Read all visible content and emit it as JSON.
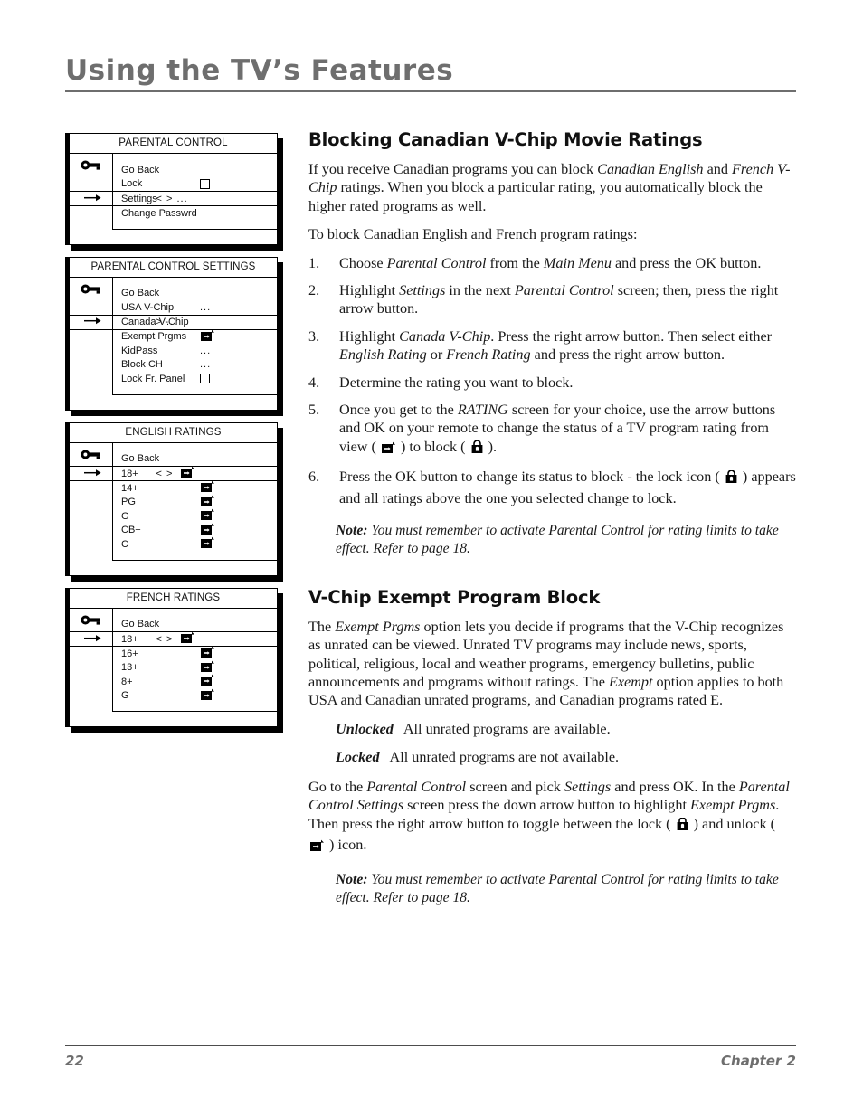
{
  "header": {
    "title": "Using the TV’s Features"
  },
  "footer": {
    "page_number": "22",
    "chapter": "Chapter 2"
  },
  "menus": [
    {
      "title": "PARENTAL CONTROL",
      "key_icon": "key-icon",
      "rows": [
        {
          "label": "Go Back",
          "value": "",
          "value_type": "none",
          "selected": false
        },
        {
          "label": "Lock",
          "value": "",
          "value_type": "checkbox",
          "selected": false
        },
        {
          "label": "Settings",
          "value": "< > ...",
          "value_type": "text",
          "selected": true
        },
        {
          "label": "Change Passwrd",
          "value": "",
          "value_type": "none",
          "selected": false
        }
      ]
    },
    {
      "title": "PARENTAL CONTROL SETTINGS",
      "key_icon": "key-icon",
      "rows": [
        {
          "label": "Go Back",
          "value": "",
          "value_type": "none",
          "selected": false
        },
        {
          "label": "USA V-Chip",
          "value": "...",
          "value_type": "text",
          "selected": false
        },
        {
          "label": "Canada V-Chip",
          "value": "> ...",
          "value_type": "text",
          "selected": true
        },
        {
          "label": "Exempt Prgms",
          "value": "",
          "value_type": "view-icon",
          "selected": false
        },
        {
          "label": "KidPass",
          "value": "...",
          "value_type": "text",
          "selected": false
        },
        {
          "label": "Block CH",
          "value": "...",
          "value_type": "text",
          "selected": false
        },
        {
          "label": "Lock Fr. Panel",
          "value": "",
          "value_type": "checkbox",
          "selected": false
        }
      ]
    },
    {
      "title": "ENGLISH RATINGS",
      "key_icon": "key-icon",
      "rows": [
        {
          "label": "Go Back",
          "value": "",
          "value_type": "none",
          "selected": false
        },
        {
          "label": "18+",
          "value": "< >",
          "value_type": "text-view-icon",
          "selected": true
        },
        {
          "label": "14+",
          "value": "",
          "value_type": "view-icon",
          "selected": false
        },
        {
          "label": "PG",
          "value": "",
          "value_type": "view-icon",
          "selected": false
        },
        {
          "label": "G",
          "value": "",
          "value_type": "view-icon",
          "selected": false
        },
        {
          "label": "CB+",
          "value": "",
          "value_type": "view-icon",
          "selected": false
        },
        {
          "label": "C",
          "value": "",
          "value_type": "view-icon",
          "selected": false
        }
      ]
    },
    {
      "title": "FRENCH RATINGS",
      "key_icon": "key-icon",
      "rows": [
        {
          "label": "Go Back",
          "value": "",
          "value_type": "none",
          "selected": false
        },
        {
          "label": "18+",
          "value": "< >",
          "value_type": "text-view-icon",
          "selected": true
        },
        {
          "label": "16+",
          "value": "",
          "value_type": "view-icon",
          "selected": false
        },
        {
          "label": "13+",
          "value": "",
          "value_type": "view-icon",
          "selected": false
        },
        {
          "label": "8+",
          "value": "",
          "value_type": "view-icon",
          "selected": false
        },
        {
          "label": "G",
          "value": "",
          "value_type": "view-icon",
          "selected": false
        }
      ]
    }
  ],
  "section1": {
    "heading": "Blocking Canadian V-Chip Movie Ratings",
    "para1_a": "If you receive Canadian programs you can block ",
    "para1_i1": "Canadian English",
    "para1_b": " and ",
    "para1_i2": "French V-Chip",
    "para1_c": " ratings. When you block a particular rating, you automatically block the higher rated programs as well.",
    "para2": "To block Canadian English and French program ratings:",
    "steps": [
      {
        "num": "1.",
        "a": "Choose ",
        "i1": "Parental Control",
        "b": " from the ",
        "i2": "Main Menu",
        "c": " and press the OK button."
      },
      {
        "num": "2.",
        "a": "Highlight ",
        "i1": "Settings",
        "b": " in the next ",
        "i2": "Parental Control",
        "c": " screen; then, press the right arrow button."
      },
      {
        "num": "3.",
        "a": "Highlight ",
        "i1": "Canada V-Chip",
        "b": ". Press the right arrow button. Then select either ",
        "i2": "English Rating",
        "c": " or ",
        "i3": "French Rating",
        "d": " and press the right arrow button."
      },
      {
        "num": "4.",
        "a": "Determine the rating you want to block."
      },
      {
        "num": "5.",
        "a": "Once you get to the ",
        "i1": "RATING",
        "b": " screen for your choice, use the arrow buttons and OK on your remote to change the status of a TV program rating from view ( ",
        "c": " ) to block ( ",
        "d": " )."
      },
      {
        "num": "6.",
        "a": "Press the OK button to change its status to block - the lock icon ( ",
        "b": " ) appears and all ratings above the one you selected change to lock."
      }
    ],
    "note_label": "Note:",
    "note_text": " You must remember to activate Parental Control for rating limits to take effect. Refer to page 18."
  },
  "section2": {
    "heading": "V-Chip Exempt Program Block",
    "para1_a": "The ",
    "para1_i1": "Exempt Prgms",
    "para1_b": " option lets you decide if programs that the V-Chip recognizes as unrated can be viewed. Unrated TV programs may include news, sports, political, religious, local and weather programs, emergency bulletins, public announcements and programs without ratings. The ",
    "para1_i2": "Exempt",
    "para1_c": " option applies to both USA and Canadian unrated programs, and Canadian programs rated E.",
    "definitions": [
      {
        "term": "Unlocked",
        "desc": "All unrated programs are available."
      },
      {
        "term": "Locked",
        "desc": "All unrated programs are not available."
      }
    ],
    "para2_a": "Go to the ",
    "para2_i1": "Parental Control",
    "para2_b": " screen and pick ",
    "para2_i2": "Settings",
    "para2_c": " and press OK. In the ",
    "para2_i3": "Parental Control Settings",
    "para2_d": " screen press the down arrow button to highlight ",
    "para2_i4": "Exempt Prgms",
    "para2_e": ". Then press the right arrow button to toggle between the lock ( ",
    "para2_f": " ) and unlock ( ",
    "para2_g": " ) icon.",
    "note_label": "Note:",
    "note_text": " You must remember to activate Parental Control for rating limits to take effect. Refer to page 18."
  },
  "icons": {
    "key": "key-icon",
    "view": "view-unlock-icon",
    "lock": "lock-icon",
    "cursor": "right-arrow-cursor-icon",
    "checkbox": "checkbox-icon"
  }
}
